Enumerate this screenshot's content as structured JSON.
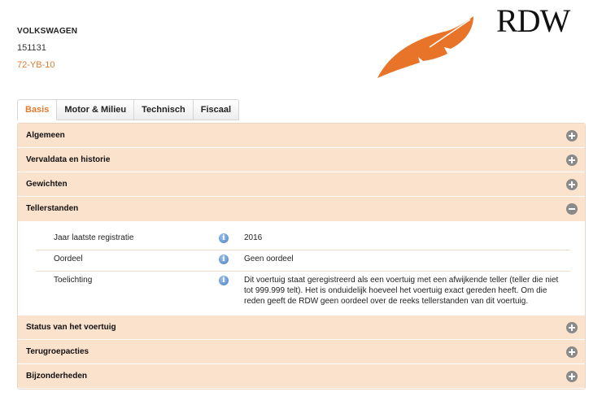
{
  "vehicle": {
    "make": "VOLKSWAGEN",
    "code": "151131",
    "plate": "72-YB-10"
  },
  "logo": {
    "text": "RDW",
    "leaf_color": "#e8742a"
  },
  "tabs": [
    {
      "label": "Basis",
      "active": true
    },
    {
      "label": "Motor & Milieu",
      "active": false
    },
    {
      "label": "Technisch",
      "active": false
    },
    {
      "label": "Fiscaal",
      "active": false
    }
  ],
  "sections": {
    "algemeen": "Algemeen",
    "vervaldata": "Vervaldata en historie",
    "gewichten": "Gewichten",
    "tellerstanden": "Tellerstanden",
    "status": "Status van het voertuig",
    "terugroep": "Terugroepacties",
    "bijzonderheden": "Bijzonderheden"
  },
  "tellerstanden": {
    "rows": [
      {
        "label": "Jaar laatste registratie",
        "value": "2016"
      },
      {
        "label": "Oordeel",
        "value": "Geen oordeel"
      },
      {
        "label": "Toelichting",
        "value": "Dit voertuig staat geregistreerd als een voertuig met een afwijkende teller (teller die niet tot 999.999 telt). Het is onduidelijk hoeveel het voertuig exact gereden heeft. Om die reden geeft de RDW geen oordeel over de reeks tellerstanden van dit voertuig."
      }
    ]
  },
  "icons": {
    "info": "i"
  },
  "colors": {
    "accent": "#e07b2e",
    "section_bg": "#fbe2cc",
    "toggle": "#8a8a8a"
  }
}
